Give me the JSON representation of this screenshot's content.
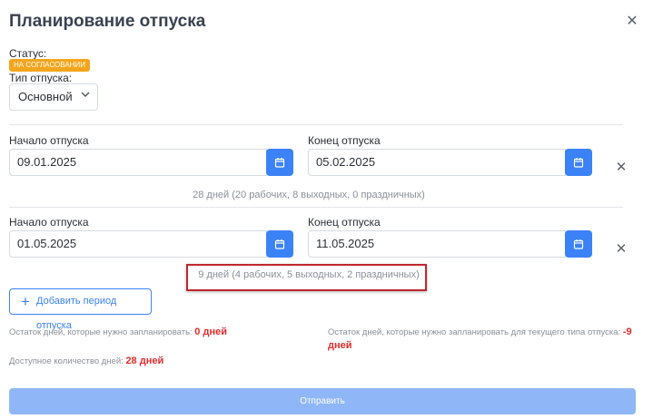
{
  "header": {
    "title": "Планирование отпуска"
  },
  "status": {
    "label": "Статус:",
    "badge": "НА СОГЛАСОВАНИИ",
    "badge_color": "#f4a51c"
  },
  "vacation_type": {
    "label": "Тип отпуска:",
    "value": "Основной"
  },
  "periods": [
    {
      "start_label": "Начало отпуска",
      "start_value": "09.01.2025",
      "end_label": "Конец отпуска",
      "end_value": "05.02.2025",
      "summary": "28 дней (20 рабочих, 8 выходных, 0 праздничных)"
    },
    {
      "start_label": "Начало отпуска",
      "start_value": "01.05.2025",
      "end_label": "Конец отпуска",
      "end_value": "11.05.2025",
      "summary": "9 дней (4 рабочих, 5 выходных, 2 праздничных)"
    }
  ],
  "add_period_label": "Добавить период отпуска",
  "remaining": {
    "label": "Остаток дней, которые нужно запланировать:",
    "value": "0 дней"
  },
  "remaining_type": {
    "label": "Остаток дней, которые нужно запланировать для текущего типа отпуска:",
    "value": "-9 дней"
  },
  "available": {
    "label": "Доступное количество дней:",
    "value": "28 дней"
  },
  "submit_label": "Отправить",
  "colors": {
    "accent": "#3b82f6",
    "submit_disabled": "#8fb7f7",
    "negative": "#e32b2b",
    "highlight_border": "#c0272d"
  }
}
